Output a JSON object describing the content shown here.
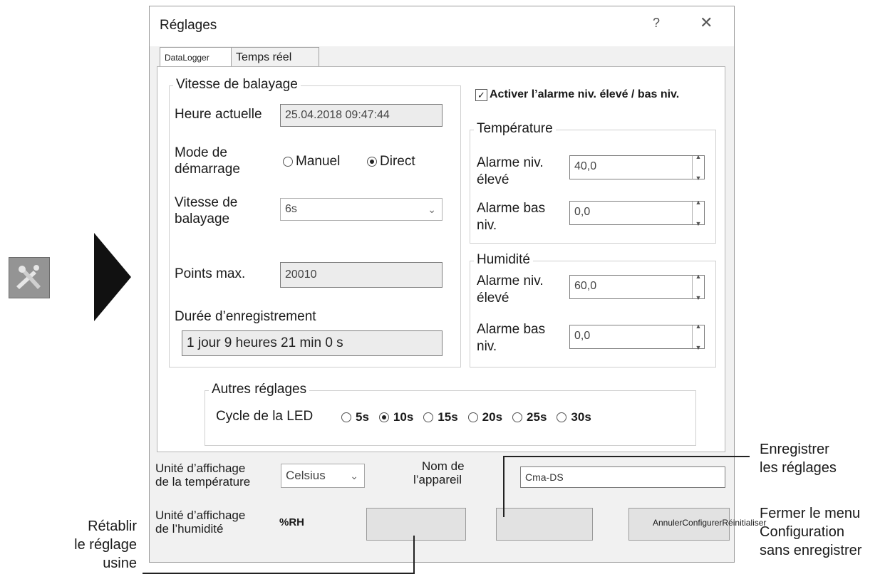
{
  "window": {
    "title": "Réglages",
    "help": "?",
    "close": "✕"
  },
  "tabs": [
    "DataLogger",
    "Temps réel"
  ],
  "sampling": {
    "group_label": "Vitesse de balayage",
    "current_time_label": "Heure actuelle",
    "current_time_value": "25.04.2018 09:47:44",
    "start_mode_label": "Mode de démarrage",
    "start_mode_line1": "Mode de",
    "start_mode_line2": "démarrage",
    "radio_manual": "Manuel",
    "radio_direct": "Direct",
    "selected_mode": "Direct",
    "rate_label_line1": "Vitesse de",
    "rate_label_line2": "balayage",
    "rate_value": "6s",
    "max_points_label": "Points max.",
    "max_points_value": "20010",
    "duration_label": "Durée d’enregistrement",
    "duration_value": "1 jour  9 heures  21 min  0 s"
  },
  "alarm": {
    "checkbox_label": "Activer l’alarme niv. élevé / bas niv.",
    "checked": true,
    "temperature": {
      "group_label": "Température",
      "high_label_line1": "Alarme niv.",
      "high_label_line2": "élevé",
      "high_value": "40,0",
      "low_label_line1": "Alarme bas",
      "low_label_line2": "niv.",
      "low_value": "0,0"
    },
    "humidity": {
      "group_label": "Humidité",
      "high_label_line1": "Alarme niv.",
      "high_label_line2": "élevé",
      "high_value": "60,0",
      "low_label_line1": "Alarme bas",
      "low_label_line2": "niv.",
      "low_value": "0,0"
    }
  },
  "other": {
    "group_label": "Autres réglages",
    "led_label": "Cycle de la LED",
    "options": [
      "5s",
      "10s",
      "15s",
      "20s",
      "25s",
      "30s"
    ],
    "selected": "10s"
  },
  "bottom": {
    "temp_unit_label_line1": "Unité d’affichage",
    "temp_unit_label_line2": "de la température",
    "temp_unit_value": "Celsius",
    "device_name_label_line1": "Nom de",
    "device_name_label_line2": "l’appareil",
    "device_name_value": "Cma-DS",
    "hum_unit_label_line1": "Unité d’affichage",
    "hum_unit_label_line2": "de l’humidité",
    "hum_unit_value": "%RH",
    "buttons_overlay_text": "AnnulerConfigurerRéinitialiser"
  },
  "callouts": {
    "save_line1": "Enregistrer",
    "save_line2": "les réglages",
    "close_line1": "Fermer le menu",
    "close_line2": "Configuration",
    "close_line3": "sans enregistrer",
    "reset_line1": "Rétablir",
    "reset_line2": "le réglage",
    "reset_line3": "usine"
  },
  "colors": {
    "window_bg": "#f1f1f1",
    "panel_bg": "#ffffff",
    "arrow": "#111111"
  },
  "icons": {
    "settings_toolbar_icon": "tools-icon",
    "pointer_arrow": "play-arrow-icon"
  }
}
